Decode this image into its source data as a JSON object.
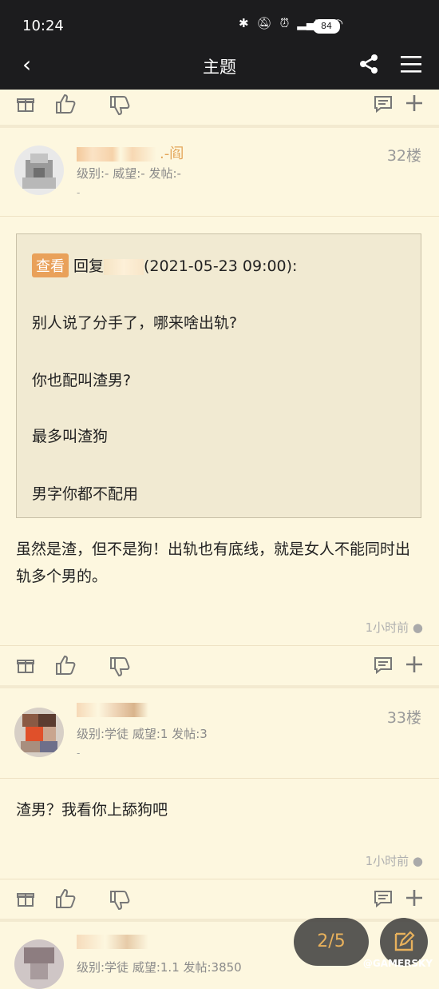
{
  "status_bar": {
    "time": "10:24",
    "battery": "84"
  },
  "nav": {
    "title": "主题"
  },
  "posts": [
    {
      "floor": "32楼",
      "nickname_suffix": ".-阎",
      "meta": "级别:- 威望:- 发帖:-",
      "dash": "-",
      "quote": {
        "badge": "查看",
        "reply_prefix": "回复",
        "reply_time": "(2021-05-23 09:00):",
        "lines": [
          "别人说了分手了，哪来啥出轨?",
          "你也配叫渣男?",
          "最多叫渣狗",
          "男字你都不配用"
        ]
      },
      "content": "虽然是渣，但不是狗！出轨也有底线，就是女人不能同时出轨多个男的。",
      "time_ago": "1小时前"
    },
    {
      "floor": "33楼",
      "meta": "级别:学徒 威望:1 发帖:3",
      "dash": "-",
      "content": "渣男？我看你上舔狗吧",
      "time_ago": "1小时前"
    },
    {
      "meta": "级别:学徒 威望:1.1 发帖:3850"
    }
  ],
  "pager": {
    "label": "2/5"
  },
  "watermark": "@GAMERSKY"
}
